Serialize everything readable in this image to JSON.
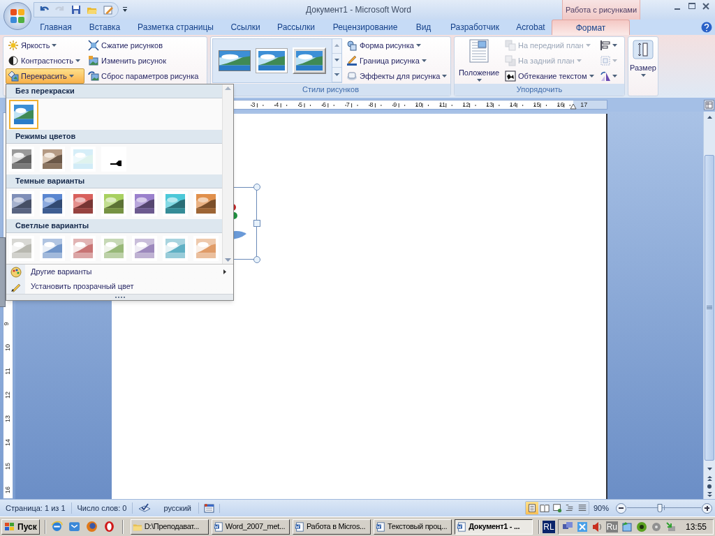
{
  "title_bar": {
    "title": "Документ1 - Microsoft Word",
    "contextual_group": "Работа с рисунками"
  },
  "quick_access": [
    {
      "kind": "undo",
      "disabled": false
    },
    {
      "kind": "redo",
      "disabled": true
    },
    {
      "kind": "save",
      "disabled": false
    },
    {
      "kind": "open",
      "disabled": false
    },
    {
      "kind": "edit",
      "disabled": false
    }
  ],
  "tabs": [
    {
      "label": "Главная",
      "selected": false,
      "contextual": false
    },
    {
      "label": "Вставка",
      "selected": false,
      "contextual": false
    },
    {
      "label": "Разметка страницы",
      "selected": false,
      "contextual": false
    },
    {
      "label": "Ссылки",
      "selected": false,
      "contextual": false
    },
    {
      "label": "Рассылки",
      "selected": false,
      "contextual": false
    },
    {
      "label": "Рецензирование",
      "selected": false,
      "contextual": false
    },
    {
      "label": "Вид",
      "selected": false,
      "contextual": false
    },
    {
      "label": "Разработчик",
      "selected": false,
      "contextual": false
    },
    {
      "label": "Acrobat",
      "selected": false,
      "contextual": false
    },
    {
      "label": "Формат",
      "selected": true,
      "contextual": true
    }
  ],
  "ribbon": {
    "adjust": {
      "columns": [
        [
          {
            "kind": "brightness",
            "label": "Яркость",
            "menu": true,
            "pressed": false
          },
          {
            "kind": "contrast",
            "label": "Контрастность",
            "menu": true,
            "pressed": false
          },
          {
            "kind": "recolor",
            "label": "Перекрасить",
            "menu": true,
            "pressed": true
          }
        ],
        [
          {
            "kind": "compress",
            "label": "Сжатие рисунков",
            "menu": false,
            "pressed": false
          },
          {
            "kind": "change",
            "label": "Изменить рисунок",
            "menu": false,
            "pressed": false
          },
          {
            "kind": "reset",
            "label": "Сброс параметров рисунка",
            "menu": false,
            "pressed": false
          }
        ]
      ]
    },
    "picture_styles": {
      "label": "Стили рисунков",
      "gallery": [
        {
          "kind": "simple-frame"
        },
        {
          "kind": "white-frame"
        },
        {
          "kind": "bevel"
        }
      ],
      "commands": [
        {
          "kind": "shape",
          "label": "Форма рисунка",
          "menu": true
        },
        {
          "kind": "border",
          "label": "Граница рисунка",
          "menu": true
        },
        {
          "kind": "effects",
          "label": "Эффекты для рисунка",
          "menu": true
        }
      ]
    },
    "arrange": {
      "label": "Упорядочить",
      "position": {
        "label": "Положение"
      },
      "commands": [
        {
          "kind": "bring-forward",
          "label": "На передний план",
          "disabled": true
        },
        {
          "kind": "send-backward",
          "label": "На задний план",
          "disabled": true
        },
        {
          "kind": "wrap",
          "label": "Обтекание текстом",
          "disabled": false
        }
      ],
      "tools": [
        {
          "kind": "align",
          "disabled": false
        },
        {
          "kind": "group",
          "disabled": true
        },
        {
          "kind": "rotate",
          "disabled": false
        }
      ]
    },
    "size": {
      "label": "Размер"
    }
  },
  "ruler": {
    "labels": [
      "3",
      "4",
      "5",
      "6",
      "7",
      "8",
      "9",
      "10",
      "11",
      "12",
      "13",
      "14",
      "15",
      "16",
      "17"
    ]
  },
  "vertical_ruler": {
    "labels": [
      "9",
      "10",
      "11",
      "12",
      "13",
      "14",
      "15",
      "16"
    ]
  },
  "recolor_menu": {
    "sections": [
      {
        "title": "Без перекраски",
        "items": [
          {
            "kind": "original",
            "selected": true
          }
        ]
      },
      {
        "title": "Режимы цветов",
        "items": [
          {
            "kind": "grayscale",
            "selected": false
          },
          {
            "kind": "sepia",
            "selected": false
          },
          {
            "kind": "washout",
            "selected": false
          },
          {
            "kind": "blackwhite",
            "selected": false
          }
        ]
      },
      {
        "title": "Темные варианты",
        "items": [
          {
            "kind": "dark",
            "color": "#7f8fb8",
            "selected": false
          },
          {
            "kind": "dark",
            "color": "#5a86d0",
            "selected": false
          },
          {
            "kind": "dark",
            "color": "#d8605c",
            "selected": false
          },
          {
            "kind": "dark",
            "color": "#a8d060",
            "selected": false
          },
          {
            "kind": "dark",
            "color": "#9a80cc",
            "selected": false
          },
          {
            "kind": "dark",
            "color": "#4cc8d8",
            "selected": false
          },
          {
            "kind": "dark",
            "color": "#e0904c",
            "selected": false
          }
        ]
      },
      {
        "title": "Светлые варианты",
        "items": [
          {
            "kind": "light",
            "color": "#b8b8b0",
            "selected": false
          },
          {
            "kind": "light",
            "color": "#6f94c8",
            "selected": false
          },
          {
            "kind": "light",
            "color": "#c87474",
            "selected": false
          },
          {
            "kind": "light",
            "color": "#98b878",
            "selected": false
          },
          {
            "kind": "light",
            "color": "#9c88bc",
            "selected": false
          },
          {
            "kind": "light",
            "color": "#60b0c4",
            "selected": false
          },
          {
            "kind": "light",
            "color": "#e09c68",
            "selected": false
          }
        ]
      }
    ],
    "commands": [
      {
        "kind": "palette",
        "label": "Другие варианты",
        "submenu": true
      },
      {
        "kind": "pencil",
        "label": "Установить прозрачный цвет",
        "submenu": false
      }
    ]
  },
  "status_bar": {
    "page": "Страница: 1 из 1",
    "words": "Число слов: 0",
    "language": "русский",
    "views": [
      {
        "kind": "print",
        "selected": true
      },
      {
        "kind": "reading",
        "selected": false
      },
      {
        "kind": "web",
        "selected": false
      },
      {
        "kind": "outline",
        "selected": false
      },
      {
        "kind": "draft",
        "selected": false
      }
    ],
    "zoom": "90%",
    "zoom_slider": {
      "level": 0.44
    }
  },
  "taskbar": {
    "start": "Пуск",
    "quick_launch": [
      {
        "kind": "ie"
      },
      {
        "kind": "mail"
      },
      {
        "kind": "fox"
      },
      {
        "kind": "ring"
      }
    ],
    "tasks": [
      {
        "kind": "folder",
        "label": "D:\\Преподават...",
        "selected": false
      },
      {
        "kind": "word",
        "label": "Word_2007_met...",
        "selected": false
      },
      {
        "kind": "word",
        "label": "Работа в Micros...",
        "selected": false
      },
      {
        "kind": "word",
        "label": "Текстовый проц...",
        "selected": false
      },
      {
        "kind": "word",
        "label": "Документ1 - ...",
        "selected": true
      }
    ],
    "language_badge": "RL",
    "tray_language": "Ru",
    "time": "13:55"
  }
}
